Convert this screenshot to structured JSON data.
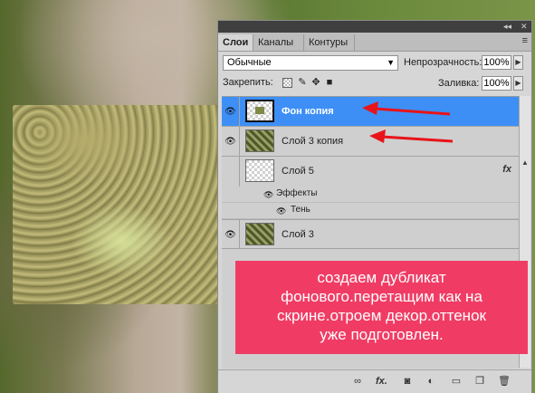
{
  "panel": {
    "topbar_controls": [
      "◂◂",
      "✕"
    ],
    "tabs": [
      {
        "label": "Слои",
        "active": true
      },
      {
        "label": "Каналы",
        "active": false
      },
      {
        "label": "Контуры",
        "active": false
      }
    ],
    "tab_menu_icon": "≡",
    "blend_mode": "Обычные",
    "opacity_label": "Непрозрачность:",
    "opacity_value": "100%",
    "lock_label": "Закрепить:",
    "fill_label": "Заливка:",
    "fill_value": "100%",
    "lock_icons": [
      "lock-transparent-icon",
      "brush-icon",
      "move-icon",
      "lock-icon"
    ],
    "layers": [
      {
        "name": "Фон копия",
        "selected": true,
        "thumb": "checker-selected"
      },
      {
        "name": "Слой 3 копия",
        "selected": false,
        "thumb": "striped"
      },
      {
        "name": "Слой 5",
        "selected": false,
        "thumb": "checker",
        "fx": "fx"
      }
    ],
    "effects_label": "Эффекты",
    "shadow_label": "Тень",
    "layer_last": "Слой 3",
    "bottom_icons": [
      "link-icon",
      "fx-icon",
      "mask-icon",
      "adjustment-icon",
      "folder-icon",
      "new-layer-icon",
      "trash-icon"
    ],
    "bottom_fx_label": "fx."
  },
  "callout": {
    "lines": [
      "создаем дубликат",
      "фонового.перетащим как на",
      "скрине.отроем декор.оттенок",
      "уже подготовлен."
    ],
    "color": "#f03c64"
  },
  "selection_color": "#3d8ff6",
  "arrow_color": "#e8141a"
}
